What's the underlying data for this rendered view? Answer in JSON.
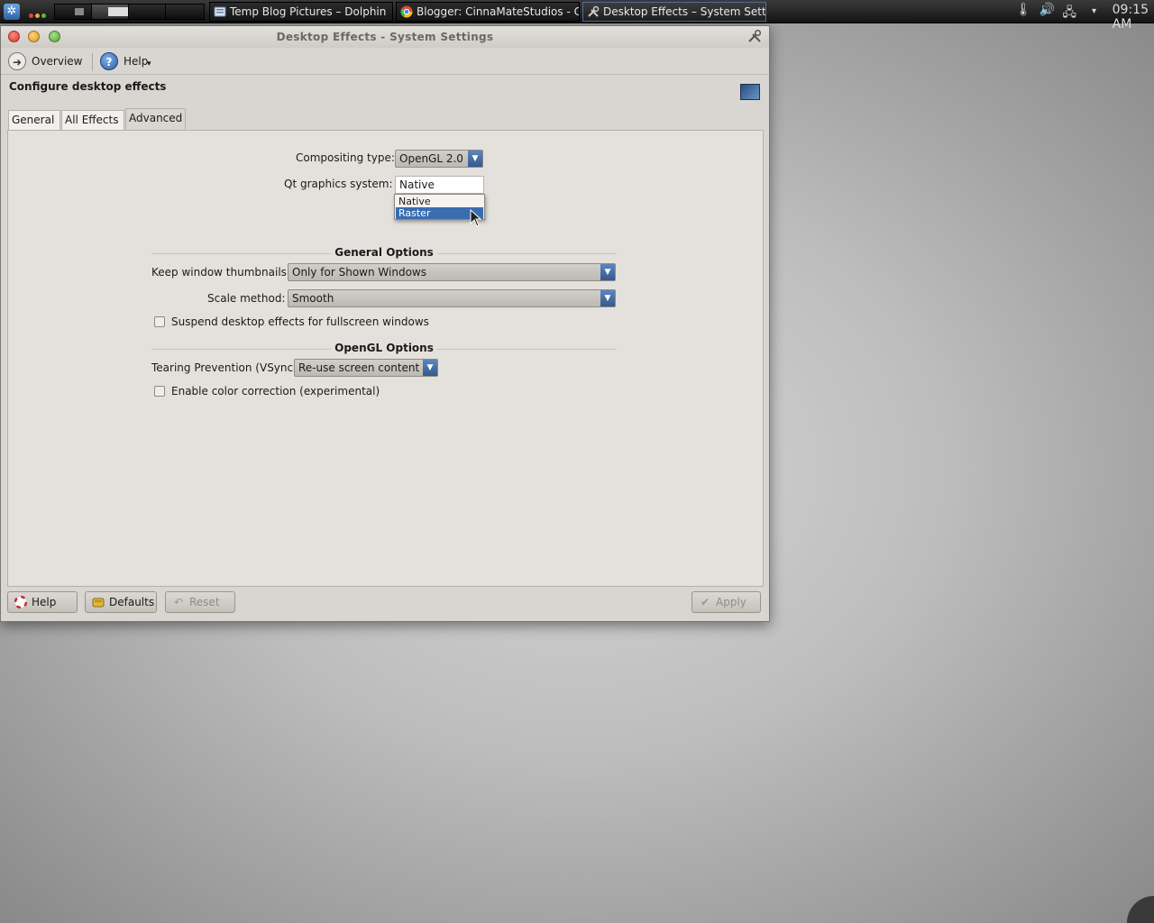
{
  "taskbar": {
    "kmenu_icon": "kde-menu-icon",
    "tasks": [
      {
        "label": "Temp Blog Pictures – Dolphin",
        "icon": "dolphin-icon"
      },
      {
        "label": "Blogger: CinnaMateStudios - C",
        "icon": "chrome-icon"
      },
      {
        "label": "Desktop Effects – System Setti",
        "icon": "system-settings-icon"
      }
    ],
    "tray": {
      "clock": "09:15 AM"
    }
  },
  "window": {
    "title": "Desktop Effects - System Settings",
    "toolbar": {
      "overview_label": "Overview",
      "help_label": "Help"
    },
    "heading": "Configure desktop effects",
    "tabs": [
      "General",
      "All Effects",
      "Advanced"
    ],
    "active_tab": "Advanced",
    "form": {
      "compositing_type_label": "Compositing type:",
      "compositing_type_value": "OpenGL 2.0",
      "qt_graphics_label": "Qt graphics system:",
      "qt_graphics_value": "Native",
      "qt_graphics_options": [
        "Native",
        "Raster"
      ],
      "qt_graphics_highlighted": "Raster",
      "general_options_heading": "General Options",
      "keep_thumbnails_label": "Keep window thumbnails:",
      "keep_thumbnails_value": "Only for Shown Windows",
      "scale_method_label": "Scale method:",
      "scale_method_value": "Smooth",
      "suspend_label": "Suspend desktop effects for fullscreen windows",
      "suspend_checked": false,
      "opengl_options_heading": "OpenGL Options",
      "tearing_label": "Tearing Prevention (VSync)",
      "tearing_value": "Re-use screen content",
      "color_correction_label": "Enable color correction (experimental)",
      "color_correction_checked": false
    },
    "buttons": {
      "help": "Help",
      "defaults": "Defaults",
      "reset": "Reset",
      "apply": "Apply"
    }
  },
  "colors": {
    "accent": "#3a6cb0",
    "combo_arrow": "#34598d",
    "window_bg": "#d9d6d1"
  }
}
